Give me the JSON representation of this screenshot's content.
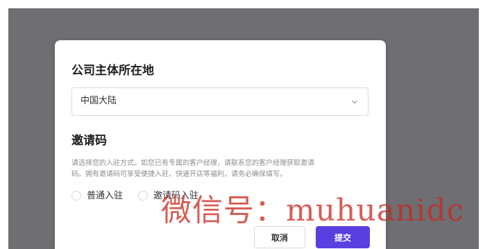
{
  "dialog": {
    "location_title": "公司主体所在地",
    "location_select": {
      "value": "中国大陆",
      "icon": "chevron-down-icon"
    },
    "invite_title": "邀请码",
    "invite_description_line1": "请选择您的入驻方式。如您已有专属的客户经理，请联系您的客户经理获取邀请",
    "invite_description_line2": "码。拥有邀请码可享受便捷入驻、快速开店等福利，请务必确保填写。",
    "options": [
      {
        "label": "普通入驻",
        "selected": false
      },
      {
        "label": "邀请码入驻",
        "selected": false
      }
    ],
    "cancel_label": "取消",
    "submit_label": "提交"
  },
  "watermark": "微信号：muhuanidc",
  "colors": {
    "overlay": "#6e6e73",
    "primary": "#5a3fe0",
    "watermark": "#c8281e"
  }
}
